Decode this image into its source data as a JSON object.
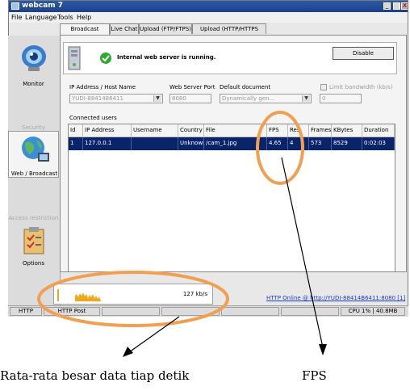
{
  "window": {
    "title": "webcam 7",
    "minimize": "_",
    "close": "X"
  },
  "menu": [
    "File",
    "Language",
    "Tools",
    "Help"
  ],
  "sidebar": {
    "items": [
      {
        "label": "Monitor",
        "icon": "webcam-eye-icon"
      },
      {
        "label": "Web / Broadcast",
        "icon": "globe-icon"
      },
      {
        "label": "Options",
        "icon": "clipboard-icon"
      }
    ],
    "sections": [
      "Security",
      "Access restriction"
    ]
  },
  "tabs": [
    "Broadcast (HTTP)",
    "Live Chat",
    "Upload (FTP/FTPS)",
    "Upload (HTTP/HTTPS POST)"
  ],
  "status": {
    "message": "Internal web server is running.",
    "disable_label": "Disable",
    "ok_color": "#2eaa2e"
  },
  "settings": {
    "ip_label": "IP Address / Host Name",
    "ip_value": "YUDI-8841486411",
    "port_label": "Web Server Port",
    "port_value": "8080",
    "doc_label": "Default document",
    "doc_value": "Dynamically gen...",
    "limit_label": "Limit bandwidth (kb/s)",
    "limit_value": "0"
  },
  "connected": {
    "label": "Connected users",
    "columns": [
      "Id",
      "IP Address",
      "Username",
      "Country",
      "File",
      "FPS",
      "Res",
      "Frames",
      "KBytes",
      "Duration"
    ],
    "rows": [
      [
        "1",
        "127.0.0.1",
        "",
        "Unknown",
        "/cam_1.jpg",
        "4.65",
        "4",
        "573",
        "8529",
        "0:02:03"
      ]
    ]
  },
  "bandwidth": {
    "value": "127 kb/s",
    "bar_color": "#f0a818"
  },
  "footer": {
    "link": "HTTP Online @ http://YUDI-88414B6411:8080 [1]",
    "cells": [
      "HTTP",
      "HTTP Post",
      "CPU 1% | 40.8MB"
    ]
  },
  "annotations": {
    "caption_left": "Rata-rata besar data tiap detik",
    "caption_right": "FPS",
    "highlight_color": "#f0a050"
  }
}
